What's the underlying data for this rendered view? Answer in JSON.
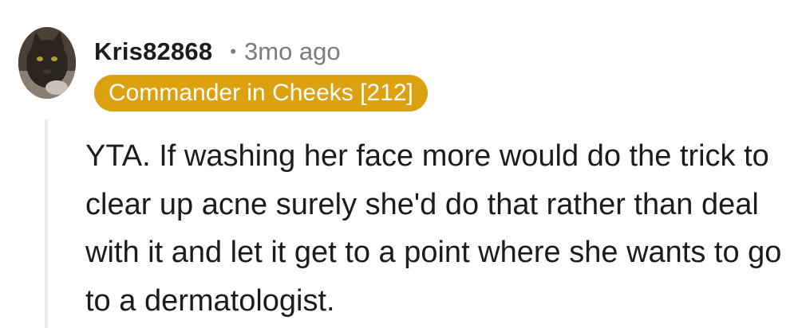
{
  "comment": {
    "username": "Kris82868",
    "separator": "•",
    "timestamp": "3mo ago",
    "flair": "Commander in Cheeks [212]",
    "body": "YTA. If washing her face more would do the trick to clear up acne surely she'd do that rather than deal with it and let it get to a point where she wants to go to a dermatologist.",
    "avatar_icon": "cat-avatar-icon",
    "colors": {
      "flair_background": "#dba10f",
      "flair_text": "#ffffff",
      "username": "#1c1c1c",
      "timestamp": "#7c7c7c",
      "body_text": "#1c1c1c",
      "thread_line": "#ececec"
    }
  }
}
